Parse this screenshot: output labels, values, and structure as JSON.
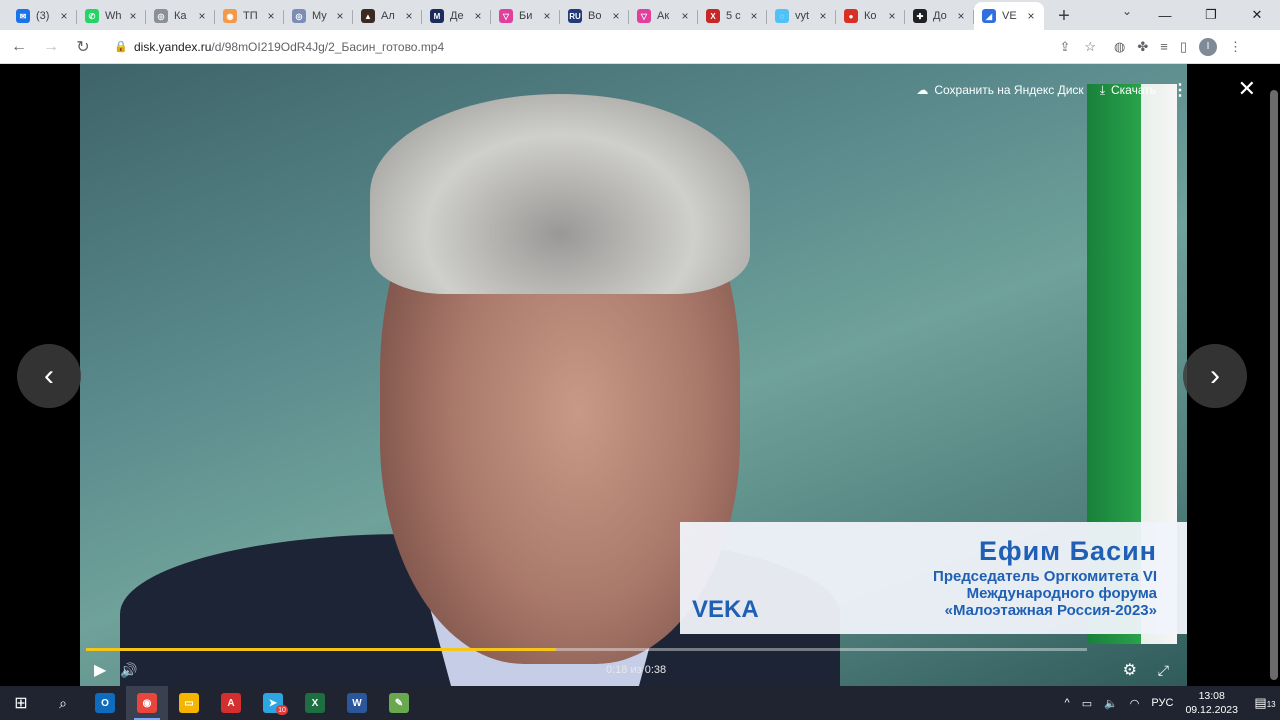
{
  "browser": {
    "tabs": [
      {
        "title": "(3)",
        "color": "#1a73e8",
        "glyph": "✉"
      },
      {
        "title": "Wh",
        "color": "#25d366",
        "glyph": "✆"
      },
      {
        "title": "Ка",
        "color": "#8a8f98",
        "glyph": "◎"
      },
      {
        "title": "ТП",
        "color": "#f2994a",
        "glyph": "◉"
      },
      {
        "title": "Му",
        "color": "#7b8db5",
        "glyph": "◎"
      },
      {
        "title": "Ал",
        "color": "#3b2a22",
        "glyph": "▲"
      },
      {
        "title": "Де",
        "color": "#1b2b5c",
        "glyph": "M"
      },
      {
        "title": "Би",
        "color": "#e0409c",
        "glyph": "▽"
      },
      {
        "title": "Во",
        "color": "#223a7a",
        "glyph": "RU"
      },
      {
        "title": "Ак",
        "color": "#e0409c",
        "glyph": "▽"
      },
      {
        "title": "5 с",
        "color": "#c62828",
        "glyph": "X"
      },
      {
        "title": "vyt",
        "color": "#4fc3f7",
        "glyph": "◌"
      },
      {
        "title": "Ко",
        "color": "#d93025",
        "glyph": "●"
      },
      {
        "title": "До",
        "color": "#202124",
        "glyph": "✚"
      },
      {
        "title": "VE",
        "color": "#2f6fe0",
        "glyph": "◢",
        "active": true
      }
    ],
    "new_tab": "+",
    "url_host": "disk.yandex.ru",
    "url_path": "/d/98mOI219OdR4Jg/2_Басин_готово.mp4"
  },
  "viewer": {
    "save_label": "Сохранить на Яндекс Диск",
    "download_label": "Скачать",
    "time_label": "0:18 из 0:38",
    "progress": 0.47,
    "lower_third": {
      "name": "Ефим Басин",
      "role_line1": "Председатель Оргкомитета VI",
      "role_line2": "Международного форума",
      "role_line3": "«Малоэтажная Россия-2023»",
      "brand": "VEKA"
    }
  },
  "taskbar": {
    "apps": [
      {
        "name": "outlook",
        "color": "#0f6cbd",
        "glyph": "O"
      },
      {
        "name": "chrome",
        "color": "#e8453c",
        "glyph": "◉",
        "active": true
      },
      {
        "name": "explorer",
        "color": "#f4b400",
        "glyph": "▭"
      },
      {
        "name": "acrobat",
        "color": "#d32f2f",
        "glyph": "A"
      },
      {
        "name": "telegram",
        "color": "#2ca5e0",
        "glyph": "➤",
        "badge": "10"
      },
      {
        "name": "excel",
        "color": "#1d6f42",
        "glyph": "X"
      },
      {
        "name": "word",
        "color": "#2b579a",
        "glyph": "W"
      },
      {
        "name": "notepad",
        "color": "#6aa84f",
        "glyph": "✎"
      }
    ],
    "lang": "РУС",
    "time": "13:08",
    "date": "09.12.2023",
    "notif_count": "13"
  }
}
